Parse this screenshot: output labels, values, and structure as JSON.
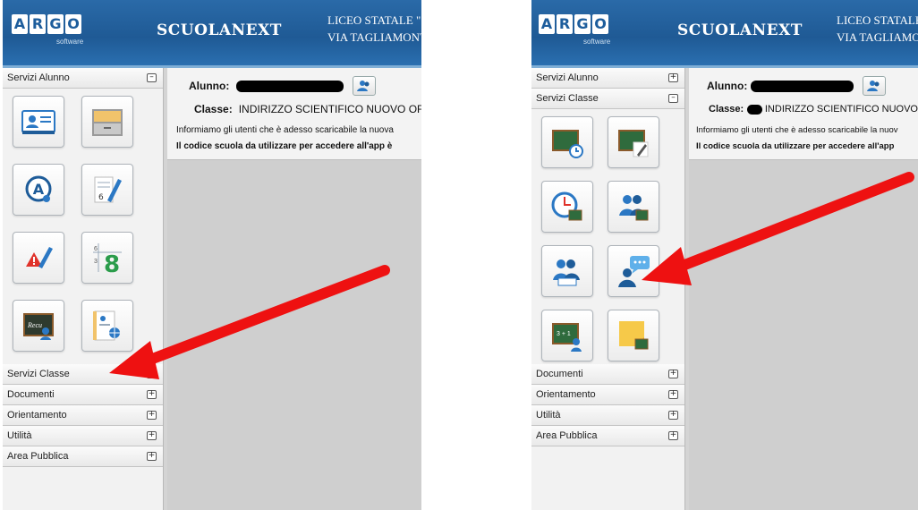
{
  "header": {
    "logo_letters": [
      "A",
      "R",
      "G",
      "O"
    ],
    "logo_sub": "software",
    "brand": "SCUOLANEXT",
    "left_school_line1": "LICEO STATALE \"",
    "left_school_line2": "VIA TAGLIAMONTE",
    "right_school_line1": "LICEO STATALE",
    "right_school_line2": "VIA TAGLIAMON"
  },
  "left_sidebar": {
    "top_section": "Servizi Alunno",
    "sections_below": [
      "Servizi Classe",
      "Documenti",
      "Orientamento",
      "Utilità",
      "Area Pubblica"
    ],
    "icons": [
      "student-card-icon",
      "file-archive-icon",
      "assessment-icon",
      "grades-pencil-icon",
      "notes-warning-icon",
      "numbers-icon",
      "recovery-board-icon",
      "profile-globe-icon"
    ]
  },
  "right_sidebar": {
    "sections_top": [
      "Servizi Alunno",
      "Servizi Classe"
    ],
    "sections_below": [
      "Documenti",
      "Orientamento",
      "Utilità",
      "Area Pubblica"
    ],
    "icons": [
      "board-clock-icon",
      "board-edit-icon",
      "timetable-board-icon",
      "group-board-icon",
      "group-school-icon",
      "teacher-chat-icon",
      "board-student-icon",
      "sticky-note-icon"
    ]
  },
  "left_main": {
    "alunno_label": "Alunno:",
    "classe_label": "Classe:",
    "classe_value": "INDIRIZZO SCIENTIFICO NUOVO OF",
    "message_line1": "Informiamo gli utenti che è adesso scaricabile la nuova",
    "message_line2": "Il codice scuola da utilizzare per accedere all'app è"
  },
  "right_main": {
    "alunno_label": "Alunno:",
    "classe_label": "Classe:",
    "classe_value": "INDIRIZZO SCIENTIFICO NUOVO",
    "message_line1": "Informiamo gli utenti che è adesso scaricabile la nuov",
    "message_line2": "Il codice scuola da utilizzare per accedere all'app"
  },
  "colors": {
    "header_blue": "#1f5a95",
    "arrow_red": "#ee1111"
  }
}
